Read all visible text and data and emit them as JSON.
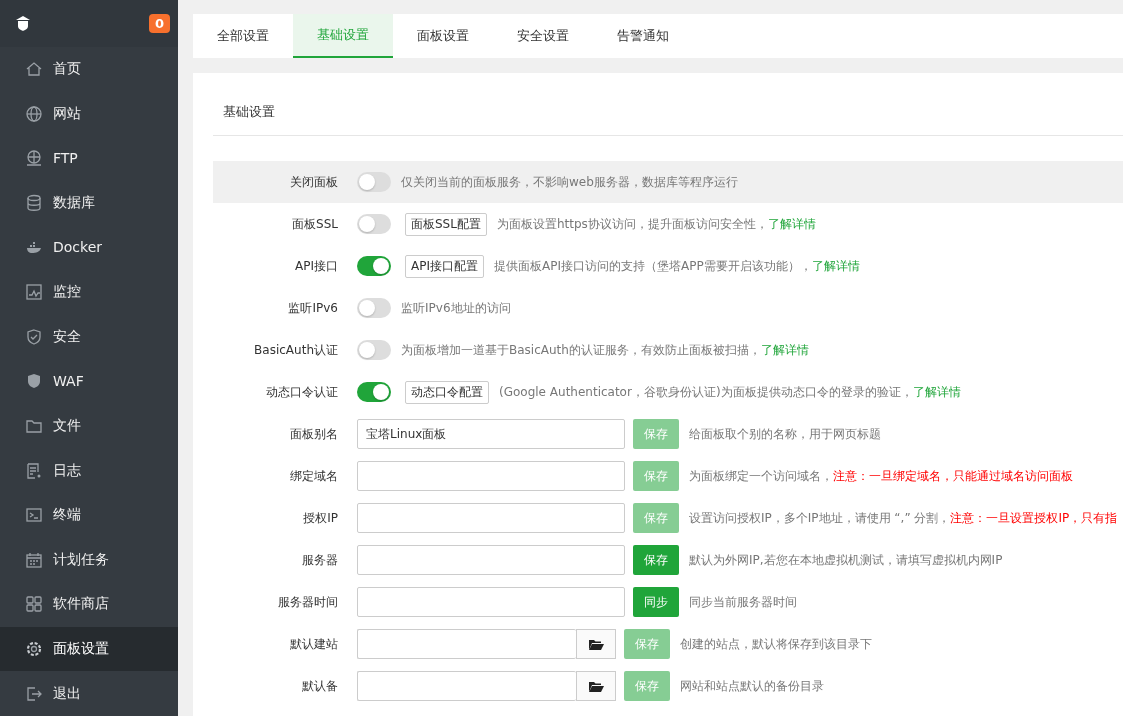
{
  "sidebar": {
    "badge": "0",
    "items": [
      {
        "label": "首页",
        "selected": false
      },
      {
        "label": "网站",
        "selected": false
      },
      {
        "label": "FTP",
        "selected": false
      },
      {
        "label": "数据库",
        "selected": false
      },
      {
        "label": "Docker",
        "selected": false
      },
      {
        "label": "监控",
        "selected": false
      },
      {
        "label": "安全",
        "selected": false
      },
      {
        "label": "WAF",
        "selected": false
      },
      {
        "label": "文件",
        "selected": false
      },
      {
        "label": "日志",
        "selected": false
      },
      {
        "label": "终端",
        "selected": false
      },
      {
        "label": "计划任务",
        "selected": false
      },
      {
        "label": "软件商店",
        "selected": false
      },
      {
        "label": "面板设置",
        "selected": true
      },
      {
        "label": "退出",
        "selected": false
      }
    ]
  },
  "tabs": [
    {
      "label": "全部设置",
      "selected": false
    },
    {
      "label": "基础设置",
      "selected": true
    },
    {
      "label": "面板设置",
      "selected": false
    },
    {
      "label": "安全设置",
      "selected": false
    },
    {
      "label": "告警通知",
      "selected": false
    }
  ],
  "section": {
    "title": "基础设置",
    "rows": [
      {
        "kind": "toggle",
        "label": "关闭面板",
        "on": false,
        "hovered": true,
        "description": [
          {
            "kind": "plain",
            "text": "仅关闭当前的面板服务，不影响web服务器，数据库等程序运行"
          }
        ]
      },
      {
        "kind": "toggle",
        "label": "面板SSL",
        "on": false,
        "hovered": false,
        "button": "面板SSL配置",
        "description": [
          {
            "kind": "plain",
            "text": "为面板设置https协议访问，提升面板访问安全性，"
          },
          {
            "kind": "link",
            "text": "了解详情"
          }
        ]
      },
      {
        "kind": "toggle",
        "label": "API接口",
        "on": true,
        "hovered": false,
        "button": "API接口配置",
        "description": [
          {
            "kind": "plain",
            "text": "提供面板API接口访问的支持（堡塔APP需要开启该功能），"
          },
          {
            "kind": "link",
            "text": "了解详情"
          }
        ]
      },
      {
        "kind": "toggle",
        "label": "监听IPv6",
        "on": false,
        "hovered": false,
        "description": [
          {
            "kind": "plain",
            "text": "监听IPv6地址的访问"
          }
        ]
      },
      {
        "kind": "toggle",
        "label": "BasicAuth认证",
        "on": false,
        "hovered": false,
        "description": [
          {
            "kind": "plain",
            "text": "为面板增加一道基于BasicAuth的认证服务，有效防止面板被扫描，"
          },
          {
            "kind": "link",
            "text": "了解详情"
          }
        ]
      },
      {
        "kind": "toggle",
        "label": "动态口令认证",
        "on": true,
        "hovered": false,
        "button": "动态口令配置",
        "description": [
          {
            "kind": "plain",
            "text": "(Google Authenticator，谷歌身份认证)为面板提供动态口令的登录的验证，"
          },
          {
            "kind": "link",
            "text": "了解详情"
          }
        ]
      },
      {
        "kind": "input",
        "label": "面板别名",
        "value": "宝塔Linux面板",
        "hovered": false,
        "button": {
          "label": "保存",
          "disabled": true
        },
        "description": [
          {
            "kind": "plain",
            "text": "给面板取个别的名称，用于网页标题"
          }
        ]
      },
      {
        "kind": "input",
        "label": "绑定域名",
        "hovered": false,
        "button": {
          "label": "保存",
          "disabled": true
        },
        "description": [
          {
            "kind": "plain",
            "text": "为面板绑定一个访问域名，"
          },
          {
            "kind": "warning",
            "text": "注意：一旦绑定域名，只能通过域名访问面板"
          }
        ]
      },
      {
        "kind": "input",
        "label": "授权IP",
        "hovered": false,
        "button": {
          "label": "保存",
          "disabled": true
        },
        "description": [
          {
            "kind": "plain",
            "text": "设置访问授权IP，多个IP地址，请使用 “,” 分割，"
          },
          {
            "kind": "warning",
            "text": "注意：一旦设置授权IP，只有指"
          }
        ]
      },
      {
        "kind": "input",
        "label": "服务器",
        "hovered": false,
        "button": {
          "label": "保存",
          "disabled": false
        },
        "description": [
          {
            "kind": "plain",
            "text": "默认为外网IP,若您在本地虚拟机测试，请填写虚拟机内网IP"
          }
        ]
      },
      {
        "kind": "input",
        "label": "服务器时间",
        "hovered": false,
        "button": {
          "label": "同步",
          "disabled": false
        },
        "description": [
          {
            "kind": "plain",
            "text": "同步当前服务器时间"
          }
        ]
      },
      {
        "kind": "path",
        "label": "默认建站",
        "hovered": false,
        "button": {
          "label": "保存",
          "disabled": true
        },
        "description": [
          {
            "kind": "plain",
            "text": "创建的站点，默认将保存到该目录下"
          }
        ]
      },
      {
        "kind": "path",
        "label": "默认备",
        "hovered": false,
        "button": {
          "label": "保存",
          "disabled": true
        },
        "description": [
          {
            "kind": "plain",
            "text": "网站和站点默认的备份目录"
          }
        ]
      }
    ]
  }
}
